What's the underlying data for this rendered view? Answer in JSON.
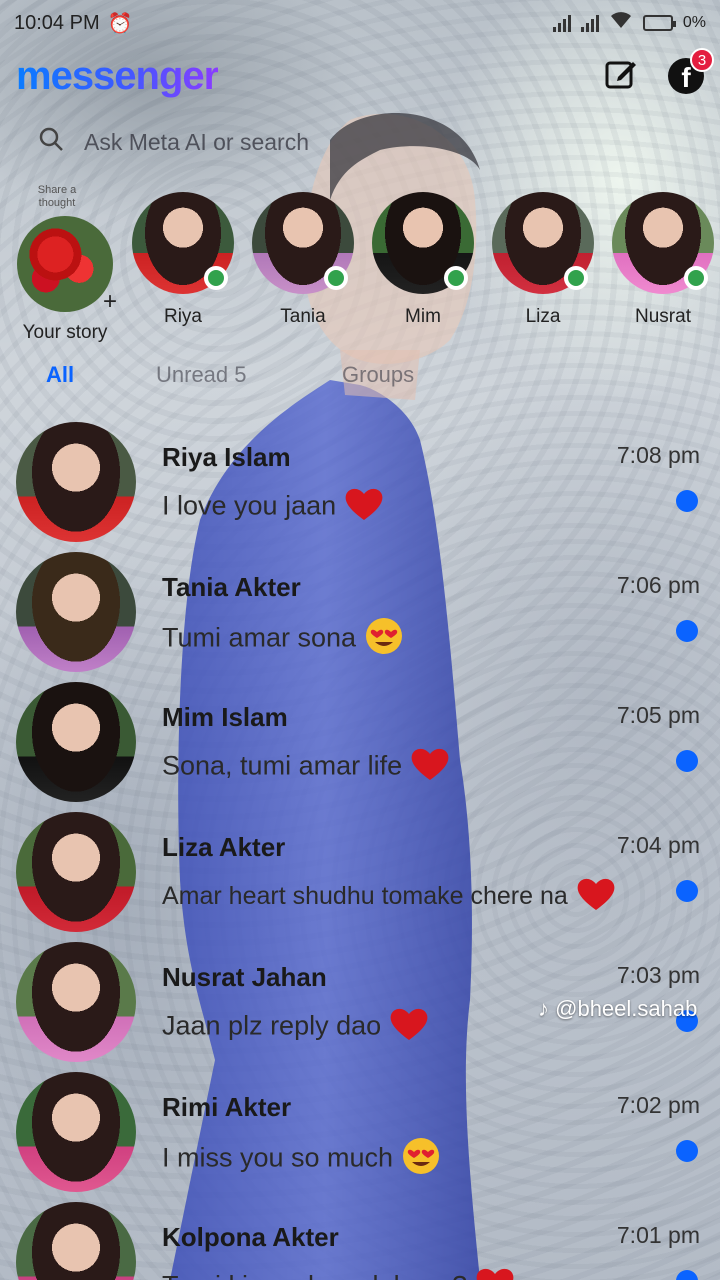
{
  "status_bar": {
    "time": "10:04 PM",
    "battery": "0%"
  },
  "header": {
    "logo": "messenger",
    "notification_count": "3"
  },
  "search": {
    "placeholder": "Ask Meta AI or search"
  },
  "stories": {
    "note_text": "Share a thought",
    "your_story_label": "Your story",
    "items": [
      {
        "name": "Riya"
      },
      {
        "name": "Tania"
      },
      {
        "name": "Mim"
      },
      {
        "name": "Liza"
      },
      {
        "name": "Nusrat"
      }
    ]
  },
  "tabs": [
    {
      "label": "All"
    },
    {
      "label": "Unread 5"
    },
    {
      "label": "Groups"
    }
  ],
  "chats": [
    {
      "name": "Riya Islam",
      "message": "I love you jaan",
      "time": "7:08 pm",
      "emoji": "heart"
    },
    {
      "name": "Tania Akter",
      "message": "Tumi amar sona",
      "time": "7:06 pm",
      "emoji": "heart-eyes"
    },
    {
      "name": "Mim Islam",
      "message": "Sona, tumi amar life",
      "time": "7:05 pm",
      "emoji": "heart"
    },
    {
      "name": "Liza Akter",
      "message": "Amar heart shudhu tomake chere na",
      "time": "7:04 pm",
      "emoji": "heart"
    },
    {
      "name": "Nusrat Jahan",
      "message": "Jaan plz reply dao",
      "time": "7:03 pm",
      "emoji": "heart"
    },
    {
      "name": "Rimi Akter",
      "message": "I miss you so much",
      "time": "7:02 pm",
      "emoji": "heart-eyes"
    },
    {
      "name": "Kolpona Akter",
      "message": "Tumi ki amake valobaso?",
      "time": "7:01 pm",
      "emoji": "heart"
    }
  ],
  "watermark": "@bheel.sahab",
  "colors": {
    "accent": "#0a63ff",
    "online": "#31a24c",
    "badge": "#e41e3f"
  }
}
